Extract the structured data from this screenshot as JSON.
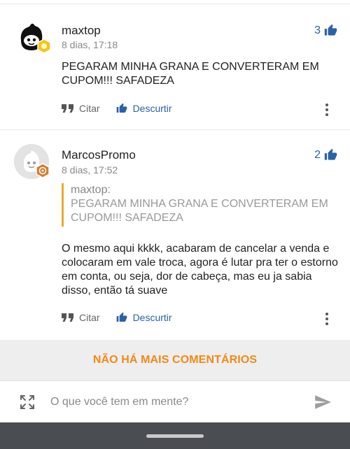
{
  "comments": [
    {
      "username": "maxtop",
      "date": "8 dias, 17:18",
      "likes": "3",
      "body": "PEGARAM MINHA GRANA E CONVERTERAM EM CUPOM!!! SAFADEZA",
      "actions": {
        "cite_label": "Citar",
        "dislike_label": "Descurtir"
      }
    },
    {
      "username": "MarcosPromo",
      "date": "8 dias, 17:52",
      "likes": "2",
      "quote": {
        "author": "maxtop:",
        "text": "PEGARAM MINHA GRANA E CONVERTERAM EM CUPOM!!! SAFADEZA"
      },
      "body": "O mesmo aqui kkkk, acabaram de cancelar a venda e colocaram em vale troca, agora é lutar pra ter o estorno em conta, ou seja, dor de cabeça, mas eu ja sabia disso, então tá suave",
      "actions": {
        "cite_label": "Citar",
        "dislike_label": "Descurtir"
      }
    }
  ],
  "footer": {
    "no_more_label": "NÃO HÁ MAIS COMENTÁRIOS"
  },
  "composer": {
    "placeholder": "O que você tem em mente?"
  },
  "colors": {
    "link_blue": "#2962a8",
    "accent_orange": "#f08a17",
    "quote_bar": "#f0a830"
  },
  "icons": [
    "thumbs-up-icon",
    "quote-icon",
    "kebab-menu-icon",
    "expand-icon",
    "send-icon"
  ]
}
